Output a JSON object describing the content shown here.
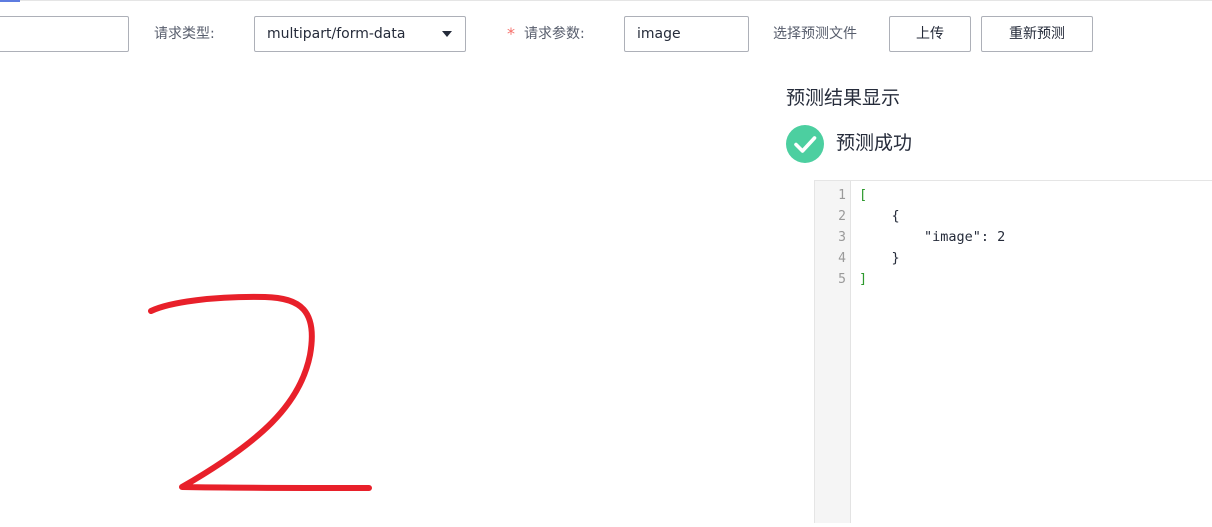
{
  "toolbar": {
    "url_value": "",
    "request_type_label": "请求类型:",
    "request_type_value": "multipart/form-data",
    "required_mark": "*",
    "request_param_label": "请求参数:",
    "request_param_value": "image",
    "choose_file_label": "选择预测文件",
    "upload_label": "上传",
    "repredict_label": "重新预测"
  },
  "canvas": {
    "drawn_digit": "2",
    "stroke_color": "#e8202a"
  },
  "result": {
    "title": "预测结果显示",
    "status": "预测成功",
    "status_color": "#4ccfa0",
    "lines": [
      {
        "no": "1",
        "text": "["
      },
      {
        "no": "2",
        "text": "    {"
      },
      {
        "no": "3",
        "text": "        \"image\": 2"
      },
      {
        "no": "4",
        "text": "    }"
      },
      {
        "no": "5",
        "text": "]"
      }
    ]
  },
  "colors": {
    "accent": "#5e7ce0",
    "required": "#f66f6a",
    "bracket": "#2e9a2e"
  }
}
